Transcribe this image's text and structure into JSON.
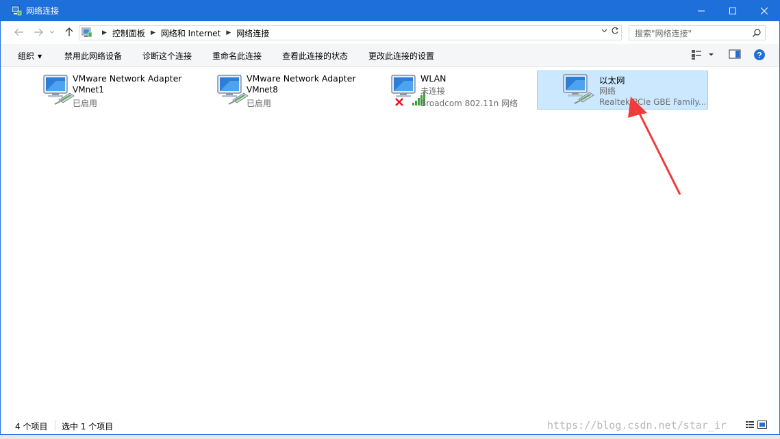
{
  "window": {
    "title": "网络连接",
    "accent": "#1e6fd9"
  },
  "address": {
    "crumbs": [
      "控制面板",
      "网络和 Internet",
      "网络连接"
    ],
    "search_placeholder": "搜索\"网络连接\""
  },
  "toolbar": {
    "organize": "组织",
    "disable": "禁用此网络设备",
    "diagnose": "诊断这个连接",
    "rename": "重命名此连接",
    "status": "查看此连接的状态",
    "settings": "更改此连接的设置"
  },
  "connections": [
    {
      "name": "VMware Network Adapter",
      "line2": "VMnet1",
      "line3": "已启用",
      "selected": false
    },
    {
      "name": "VMware Network Adapter",
      "line2": "VMnet8",
      "line3": "已启用",
      "selected": false
    },
    {
      "name": "WLAN",
      "line2": "未连接",
      "line3": "Broadcom 802.11n 网络",
      "selected": false
    },
    {
      "name": "以太网",
      "line2": "网络",
      "line3": "Realtek PCIe GBE Family...",
      "selected": true
    }
  ],
  "status": {
    "count": "4 个项目",
    "selected": "选中 1 个项目"
  },
  "watermark": "https://blog.csdn.net/star_ir"
}
